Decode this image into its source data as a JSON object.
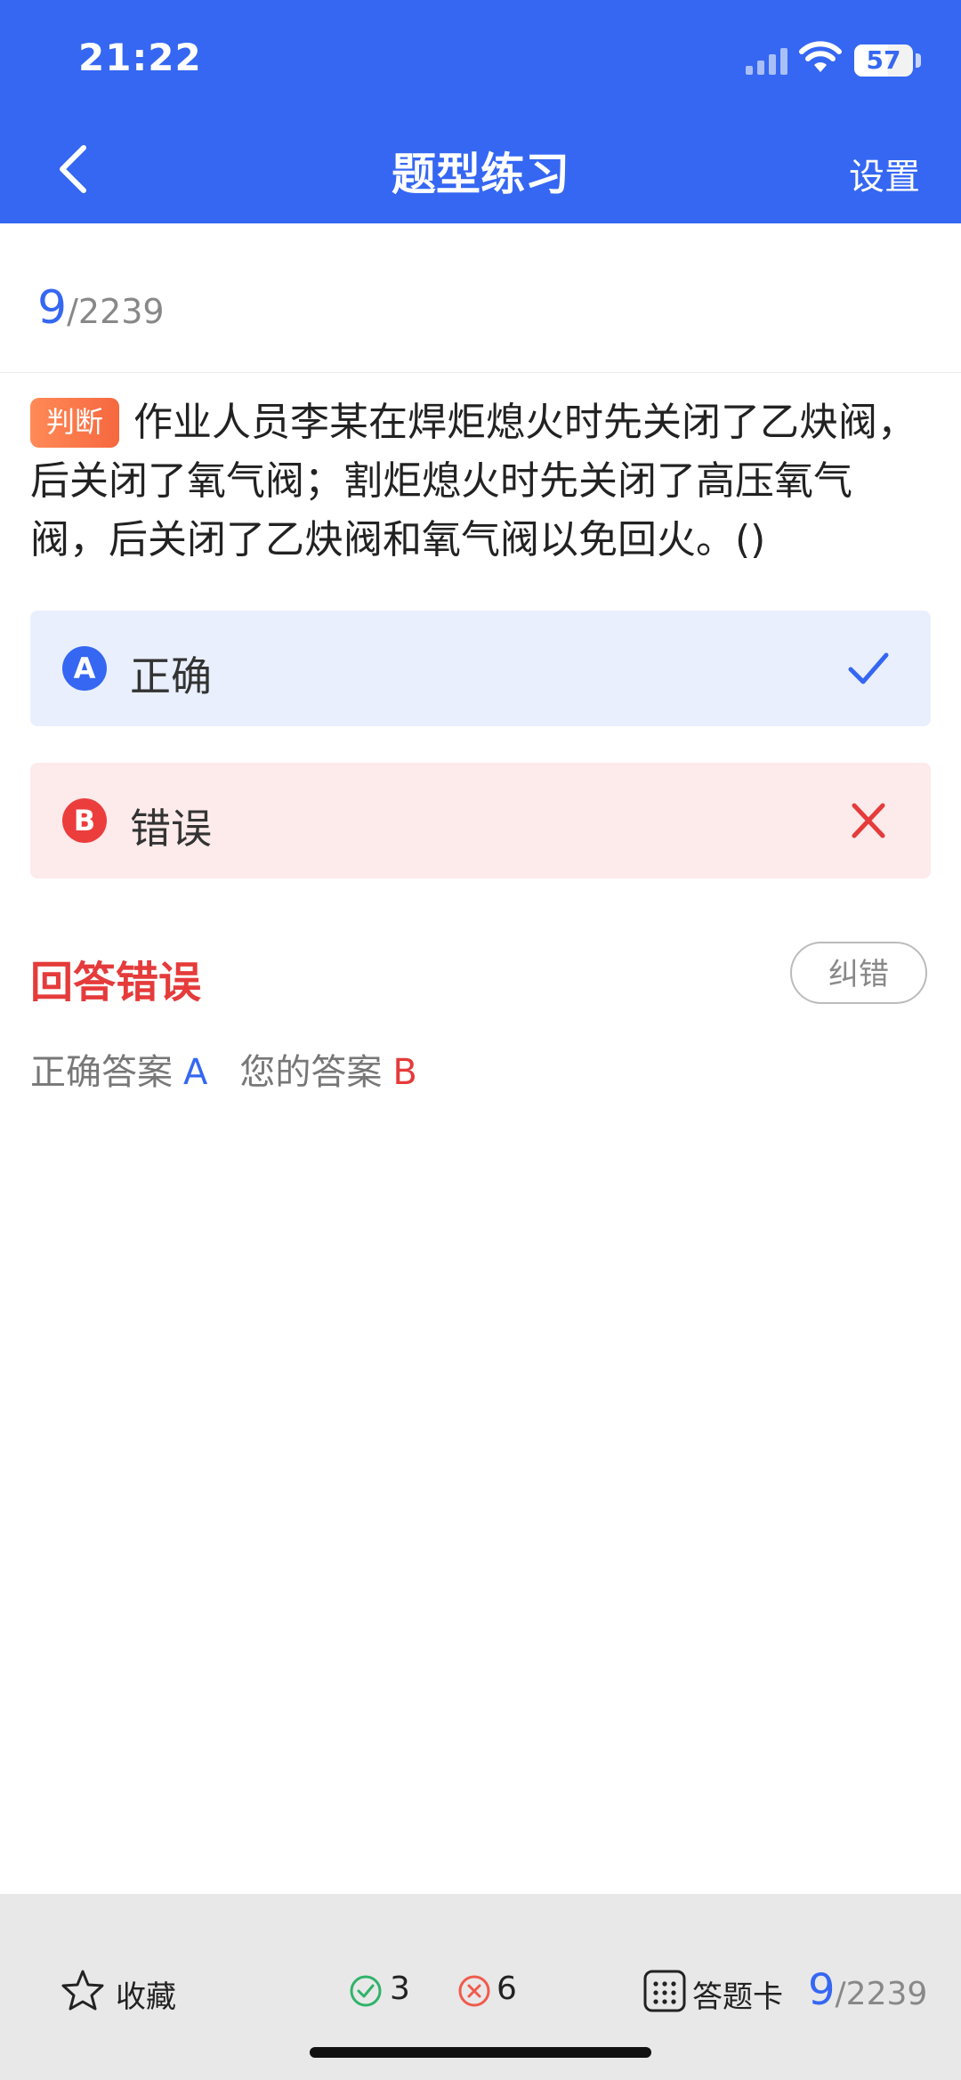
{
  "status_bar": {
    "time": "21:22",
    "battery": "57",
    "battery_level": 0.57
  },
  "header": {
    "title": "题型练习",
    "settings_label": "设置"
  },
  "progress": {
    "current": "9",
    "total": "/2239"
  },
  "question": {
    "type_tag": "判断",
    "text": "作业人员李某在焊炬熄火时先关闭了乙炔阀，后关闭了氧气阀；割炬熄火时先关闭了高压氧气阀，后关闭了乙炔阀和氧气阀以免回火。()"
  },
  "options": [
    {
      "letter": "A",
      "label": "正确",
      "state": "correct",
      "mark_icon": "check-icon"
    },
    {
      "letter": "B",
      "label": "错误",
      "state": "wrong",
      "mark_icon": "cross-icon"
    }
  ],
  "result": {
    "status_text": "回答错误",
    "report_button": "纠错",
    "correct_label": "正确答案",
    "correct_value": "A",
    "user_label": "您的答案",
    "user_value": "B"
  },
  "bottom_bar": {
    "favorite_label": "收藏",
    "correct_count": "3",
    "wrong_count": "6",
    "answer_card_label": "答题卡",
    "current": "9",
    "total": "/2239"
  },
  "colors": {
    "primary": "#3567f2",
    "error": "#e53b3b",
    "tag_orange": "#f6683f",
    "option_a_bg": "#e9effd",
    "option_b_bg": "#fdeaea",
    "bottom_bar_bg": "#e8e8e8"
  }
}
